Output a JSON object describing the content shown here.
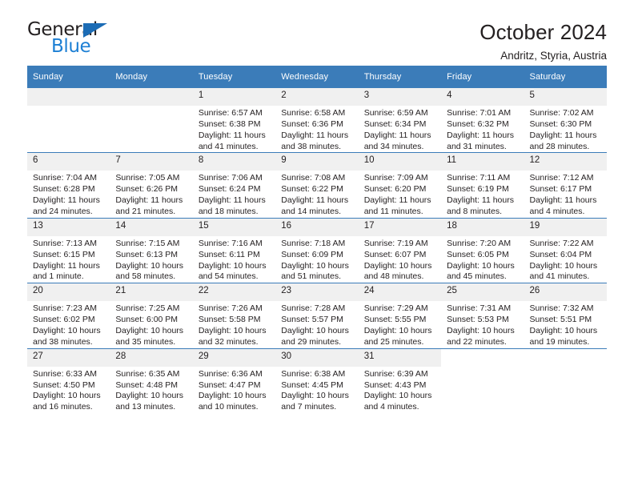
{
  "brand": {
    "word_one": "General",
    "word_two": "Blue",
    "triangle_color": "#1c6cb5",
    "blue_color": "#1c7fd4"
  },
  "header": {
    "title": "October 2024",
    "subtitle": "Andritz, Styria, Austria"
  },
  "theme": {
    "header_blue": "#3b7cb9",
    "daynum_gray": "#f0f0f0",
    "text": "#231f20"
  },
  "weekday_headers": [
    "Sunday",
    "Monday",
    "Tuesday",
    "Wednesday",
    "Thursday",
    "Friday",
    "Saturday"
  ],
  "weeks": [
    [
      {
        "day": "",
        "sunrise": "",
        "sunset": "",
        "daylight_line1": "",
        "daylight_line2": ""
      },
      {
        "day": "",
        "sunrise": "",
        "sunset": "",
        "daylight_line1": "",
        "daylight_line2": ""
      },
      {
        "day": "1",
        "sunrise": "Sunrise: 6:57 AM",
        "sunset": "Sunset: 6:38 PM",
        "daylight_line1": "Daylight: 11 hours",
        "daylight_line2": "and 41 minutes."
      },
      {
        "day": "2",
        "sunrise": "Sunrise: 6:58 AM",
        "sunset": "Sunset: 6:36 PM",
        "daylight_line1": "Daylight: 11 hours",
        "daylight_line2": "and 38 minutes."
      },
      {
        "day": "3",
        "sunrise": "Sunrise: 6:59 AM",
        "sunset": "Sunset: 6:34 PM",
        "daylight_line1": "Daylight: 11 hours",
        "daylight_line2": "and 34 minutes."
      },
      {
        "day": "4",
        "sunrise": "Sunrise: 7:01 AM",
        "sunset": "Sunset: 6:32 PM",
        "daylight_line1": "Daylight: 11 hours",
        "daylight_line2": "and 31 minutes."
      },
      {
        "day": "5",
        "sunrise": "Sunrise: 7:02 AM",
        "sunset": "Sunset: 6:30 PM",
        "daylight_line1": "Daylight: 11 hours",
        "daylight_line2": "and 28 minutes."
      }
    ],
    [
      {
        "day": "6",
        "sunrise": "Sunrise: 7:04 AM",
        "sunset": "Sunset: 6:28 PM",
        "daylight_line1": "Daylight: 11 hours",
        "daylight_line2": "and 24 minutes."
      },
      {
        "day": "7",
        "sunrise": "Sunrise: 7:05 AM",
        "sunset": "Sunset: 6:26 PM",
        "daylight_line1": "Daylight: 11 hours",
        "daylight_line2": "and 21 minutes."
      },
      {
        "day": "8",
        "sunrise": "Sunrise: 7:06 AM",
        "sunset": "Sunset: 6:24 PM",
        "daylight_line1": "Daylight: 11 hours",
        "daylight_line2": "and 18 minutes."
      },
      {
        "day": "9",
        "sunrise": "Sunrise: 7:08 AM",
        "sunset": "Sunset: 6:22 PM",
        "daylight_line1": "Daylight: 11 hours",
        "daylight_line2": "and 14 minutes."
      },
      {
        "day": "10",
        "sunrise": "Sunrise: 7:09 AM",
        "sunset": "Sunset: 6:20 PM",
        "daylight_line1": "Daylight: 11 hours",
        "daylight_line2": "and 11 minutes."
      },
      {
        "day": "11",
        "sunrise": "Sunrise: 7:11 AM",
        "sunset": "Sunset: 6:19 PM",
        "daylight_line1": "Daylight: 11 hours",
        "daylight_line2": "and 8 minutes."
      },
      {
        "day": "12",
        "sunrise": "Sunrise: 7:12 AM",
        "sunset": "Sunset: 6:17 PM",
        "daylight_line1": "Daylight: 11 hours",
        "daylight_line2": "and 4 minutes."
      }
    ],
    [
      {
        "day": "13",
        "sunrise": "Sunrise: 7:13 AM",
        "sunset": "Sunset: 6:15 PM",
        "daylight_line1": "Daylight: 11 hours",
        "daylight_line2": "and 1 minute."
      },
      {
        "day": "14",
        "sunrise": "Sunrise: 7:15 AM",
        "sunset": "Sunset: 6:13 PM",
        "daylight_line1": "Daylight: 10 hours",
        "daylight_line2": "and 58 minutes."
      },
      {
        "day": "15",
        "sunrise": "Sunrise: 7:16 AM",
        "sunset": "Sunset: 6:11 PM",
        "daylight_line1": "Daylight: 10 hours",
        "daylight_line2": "and 54 minutes."
      },
      {
        "day": "16",
        "sunrise": "Sunrise: 7:18 AM",
        "sunset": "Sunset: 6:09 PM",
        "daylight_line1": "Daylight: 10 hours",
        "daylight_line2": "and 51 minutes."
      },
      {
        "day": "17",
        "sunrise": "Sunrise: 7:19 AM",
        "sunset": "Sunset: 6:07 PM",
        "daylight_line1": "Daylight: 10 hours",
        "daylight_line2": "and 48 minutes."
      },
      {
        "day": "18",
        "sunrise": "Sunrise: 7:20 AM",
        "sunset": "Sunset: 6:05 PM",
        "daylight_line1": "Daylight: 10 hours",
        "daylight_line2": "and 45 minutes."
      },
      {
        "day": "19",
        "sunrise": "Sunrise: 7:22 AM",
        "sunset": "Sunset: 6:04 PM",
        "daylight_line1": "Daylight: 10 hours",
        "daylight_line2": "and 41 minutes."
      }
    ],
    [
      {
        "day": "20",
        "sunrise": "Sunrise: 7:23 AM",
        "sunset": "Sunset: 6:02 PM",
        "daylight_line1": "Daylight: 10 hours",
        "daylight_line2": "and 38 minutes."
      },
      {
        "day": "21",
        "sunrise": "Sunrise: 7:25 AM",
        "sunset": "Sunset: 6:00 PM",
        "daylight_line1": "Daylight: 10 hours",
        "daylight_line2": "and 35 minutes."
      },
      {
        "day": "22",
        "sunrise": "Sunrise: 7:26 AM",
        "sunset": "Sunset: 5:58 PM",
        "daylight_line1": "Daylight: 10 hours",
        "daylight_line2": "and 32 minutes."
      },
      {
        "day": "23",
        "sunrise": "Sunrise: 7:28 AM",
        "sunset": "Sunset: 5:57 PM",
        "daylight_line1": "Daylight: 10 hours",
        "daylight_line2": "and 29 minutes."
      },
      {
        "day": "24",
        "sunrise": "Sunrise: 7:29 AM",
        "sunset": "Sunset: 5:55 PM",
        "daylight_line1": "Daylight: 10 hours",
        "daylight_line2": "and 25 minutes."
      },
      {
        "day": "25",
        "sunrise": "Sunrise: 7:31 AM",
        "sunset": "Sunset: 5:53 PM",
        "daylight_line1": "Daylight: 10 hours",
        "daylight_line2": "and 22 minutes."
      },
      {
        "day": "26",
        "sunrise": "Sunrise: 7:32 AM",
        "sunset": "Sunset: 5:51 PM",
        "daylight_line1": "Daylight: 10 hours",
        "daylight_line2": "and 19 minutes."
      }
    ],
    [
      {
        "day": "27",
        "sunrise": "Sunrise: 6:33 AM",
        "sunset": "Sunset: 4:50 PM",
        "daylight_line1": "Daylight: 10 hours",
        "daylight_line2": "and 16 minutes."
      },
      {
        "day": "28",
        "sunrise": "Sunrise: 6:35 AM",
        "sunset": "Sunset: 4:48 PM",
        "daylight_line1": "Daylight: 10 hours",
        "daylight_line2": "and 13 minutes."
      },
      {
        "day": "29",
        "sunrise": "Sunrise: 6:36 AM",
        "sunset": "Sunset: 4:47 PM",
        "daylight_line1": "Daylight: 10 hours",
        "daylight_line2": "and 10 minutes."
      },
      {
        "day": "30",
        "sunrise": "Sunrise: 6:38 AM",
        "sunset": "Sunset: 4:45 PM",
        "daylight_line1": "Daylight: 10 hours",
        "daylight_line2": "and 7 minutes."
      },
      {
        "day": "31",
        "sunrise": "Sunrise: 6:39 AM",
        "sunset": "Sunset: 4:43 PM",
        "daylight_line1": "Daylight: 10 hours",
        "daylight_line2": "and 4 minutes."
      },
      {
        "day": "",
        "sunrise": "",
        "sunset": "",
        "daylight_line1": "",
        "daylight_line2": ""
      },
      {
        "day": "",
        "sunrise": "",
        "sunset": "",
        "daylight_line1": "",
        "daylight_line2": ""
      }
    ]
  ]
}
